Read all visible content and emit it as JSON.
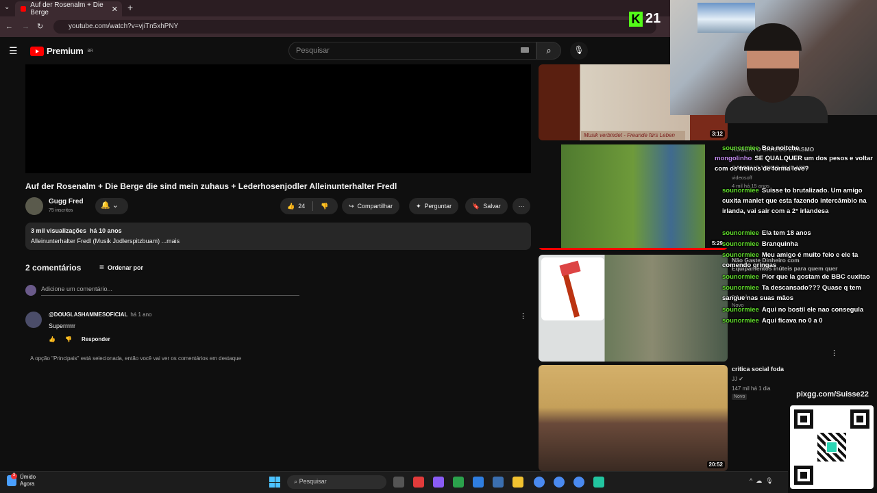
{
  "browser": {
    "tab_title": "Auf der Rosenalm + Die Berge",
    "url": "youtube.com/watch?v=vjiTn5xhPNY"
  },
  "header": {
    "logo_text": "Premium",
    "region": "BR",
    "search_placeholder": "Pesquisar"
  },
  "video": {
    "title": "Auf der Rosenalm + Die Berge die sind mein zuhaus + Lederhosenjodler Alleinunterhalter Fredl",
    "channel": "Gugg Fred",
    "subscribers": "75 inscritos",
    "likes": "24",
    "share_label": "Compartilhar",
    "ask_label": "Perguntar",
    "save_label": "Salvar",
    "views": "3 mil visualizações",
    "age": "há 10 anos",
    "description": "Alleinunterhalter Fredl (Musik  Jodlerspitzbuam) ...mais"
  },
  "comments": {
    "count_label": "2 comentários",
    "sort_label": "Ordenar por",
    "add_placeholder": "Adicione um comentário...",
    "items": [
      {
        "author": "@DOUGLASHAMMESOFICIAL",
        "time": "há 1 ano",
        "text": "Superrrrrr",
        "reply_label": "Responder"
      }
    ],
    "hint": "A opção \"Principais\" está selecionada, então você vai ver os comentários em destaque"
  },
  "recommendations": [
    {
      "duration": "3:12",
      "banner": "Musik verbindet - Freunde fürs Leben"
    },
    {
      "duration": "5:29"
    },
    {
      "duration": ""
    },
    {
      "duration": "20:52",
      "title": "critica social foda",
      "channel": "JJ",
      "meta": "147 mil  há 1 dia",
      "badge": "Novo"
    }
  ],
  "stream": {
    "kick_label": "K",
    "viewer_count": "21",
    "pix_url": "pixgg.com/Suisse22"
  },
  "chat": {
    "messages": [
      {
        "user": "sounormiee",
        "text": "Boa noitche"
      },
      {
        "user": "mongolinho",
        "text": "SE QUALQUER um dos pesos e voltar com os treinos de forma leve?"
      },
      {
        "user": "sounormiee",
        "text": "Suisse to brutalizado. Um amigo cuxita manlet que esta fazendo intercâmbio na irlanda, vai sair com a 2° irlandesa"
      },
      {
        "user": "sounormiee",
        "text": "Ela tem 18 anos"
      },
      {
        "user": "sounormiee",
        "text": "Branquinha"
      },
      {
        "user": "sounormiee",
        "text": "Meu amigo é muito feio e ele ta comendo gringas"
      },
      {
        "user": "sounormiee",
        "text": "Pior que la gostam de BBC cuxitao"
      },
      {
        "user": "sounormiee",
        "text": "Ta descansado??? Quase q tem sangue nas suas mãos"
      },
      {
        "user": "sounormiee",
        "text": "Aqui no bostil ele nao consegula"
      },
      {
        "user": "sounormiee",
        "text": "Aqui ficava no 0 a 0"
      }
    ],
    "ghosts": [
      "ROBERTO CARLOS ERASMO",
      "CAMINHO VIDEO CLIP 1980",
      "videosoff",
      "4 mil  há 15 anos",
      "Não Gaste Dinheiro com",
      "Equipamentos Inúteis para quem quer",
      "2,1 mil",
      "Novo"
    ]
  },
  "taskbar": {
    "weather": "Úmido",
    "weather_time": "Agora",
    "weather_badge": "3",
    "search": "Pesquisar"
  },
  "colors": {
    "accent": "#ff0000",
    "chat_user": "#5fdc2a",
    "kick": "#53fc18"
  }
}
